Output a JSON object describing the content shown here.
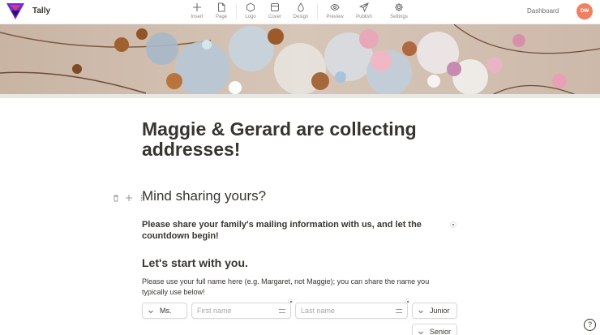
{
  "app": {
    "name": "Tally"
  },
  "toolbar": [
    {
      "id": "insert",
      "label": "Insert",
      "icon": "plus-icon"
    },
    {
      "id": "page",
      "label": "Page",
      "icon": "page-icon"
    },
    {
      "id": "logo",
      "label": "Logo",
      "icon": "hexagon-icon"
    },
    {
      "id": "cover",
      "label": "Cover",
      "icon": "cover-icon"
    },
    {
      "id": "design",
      "label": "Design",
      "icon": "droplet-icon"
    },
    {
      "id": "preview",
      "label": "Preview",
      "icon": "eye-icon"
    },
    {
      "id": "publish",
      "label": "Publish",
      "icon": "send-icon"
    },
    {
      "id": "settings",
      "label": "Settings",
      "icon": "gear-icon"
    }
  ],
  "header": {
    "dashboard_label": "Dashboard",
    "avatar_initials": "D₩"
  },
  "form": {
    "title": "Maggie & Gerard are collecting addresses!",
    "heading": "Mind sharing yours?",
    "intro": "Please share your family's mailing information with us, and let the countdown begin!",
    "subheading": "Let's start with you.",
    "helper": "Please use your full name here (e.g. Margaret, not Maggie); you can share the name you typically use below!",
    "fields": {
      "title_select": "Ms.",
      "first_name_placeholder": "First name",
      "last_name_placeholder": "Last name",
      "suffix_select": "Junior",
      "suffix_select_2": "Senior"
    }
  },
  "help_label": "?",
  "colors": {
    "avatar": "#f08060",
    "logo_purple": "#6b2dd6",
    "logo_pink": "#e0337a"
  }
}
